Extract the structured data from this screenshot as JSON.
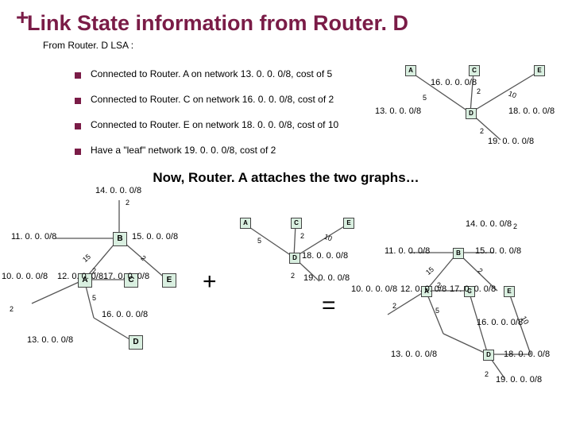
{
  "header": {
    "title": "Link State information from Router. D",
    "subtitle": "From Router. D LSA :"
  },
  "bullets": [
    "Connected to Router. A on network 13. 0. 0. 0/8, cost of 5",
    "Connected to Router. C on network 16. 0. 0. 0/8, cost of 2",
    "Connected to Router. E on network 18. 0. 0. 0/8, cost of 10",
    "Have a \"leaf\" network 19. 0. 0. 0/8, cost of 2"
  ],
  "now_line": "Now, Router. A attaches the two graphs…",
  "operators": {
    "plus": "+",
    "equals": "="
  },
  "networks": {
    "n10": "10. 0. 0. 0/8",
    "n11": "11. 0. 0. 0/8",
    "n12": "12. 0. 0. 0/8",
    "n13": "13. 0. 0. 0/8",
    "n14": "14. 0. 0. 0/8",
    "n15": "15. 0. 0. 0/8",
    "n16": "16. 0. 0. 0/8",
    "n17": "17. 0. 0. 0/8",
    "n18": "18. 0. 0. 0/8",
    "n19": "19. 0. 0. 0/8"
  },
  "costs": {
    "c2": "2",
    "c5": "5",
    "c10": "10",
    "c15": "15"
  },
  "nodes": {
    "A": "A",
    "B": "B",
    "C": "C",
    "D": "D",
    "E": "E"
  },
  "chart_data": {
    "type": "diagram",
    "topology": {
      "routers": [
        "A",
        "B",
        "C",
        "D",
        "E"
      ],
      "links": [
        {
          "between": [
            "A",
            null
          ],
          "network": "10.0.0.0/8",
          "cost": 2,
          "leaf": true
        },
        {
          "between": [
            "B",
            null
          ],
          "network": "11.0.0.0/8",
          "cost": null,
          "leaf": true
        },
        {
          "between": [
            "A",
            "C"
          ],
          "network": "12.0.0.0/8",
          "cost": 2,
          "leaf": false
        },
        {
          "between": [
            "A",
            "D"
          ],
          "network": "13.0.0.0/8",
          "cost": 5,
          "leaf": false
        },
        {
          "between": [
            "B",
            null
          ],
          "network": "14.0.0.0/8",
          "cost": 2,
          "leaf": true
        },
        {
          "between": [
            "A",
            "B"
          ],
          "network": "15.0.0.0/8",
          "cost": 15,
          "leaf": false
        },
        {
          "between": [
            "C",
            "D"
          ],
          "network": "16.0.0.0/8",
          "cost": 2,
          "leaf": false
        },
        {
          "between": [
            "C",
            "E"
          ],
          "network": "17.0.0.0/8",
          "cost": null,
          "leaf": false
        },
        {
          "between": [
            "D",
            "E"
          ],
          "network": "18.0.0.0/8",
          "cost": 10,
          "leaf": false
        },
        {
          "between": [
            "D",
            null
          ],
          "network": "19.0.0.0/8",
          "cost": 2,
          "leaf": true
        }
      ]
    },
    "lsa_from": "D",
    "lsa_entries": [
      {
        "to": "A",
        "network": "13.0.0.0/8",
        "cost": 5
      },
      {
        "to": "C",
        "network": "16.0.0.0/8",
        "cost": 2
      },
      {
        "to": "E",
        "network": "18.0.0.0/8",
        "cost": 10
      },
      {
        "leaf": true,
        "network": "19.0.0.0/8",
        "cost": 2
      }
    ],
    "operation": "Router A attaches its existing graph with the Router D LSA graph",
    "figures": [
      "router_a_known_graph",
      "router_d_lsa_graph",
      "merged_graph"
    ]
  }
}
